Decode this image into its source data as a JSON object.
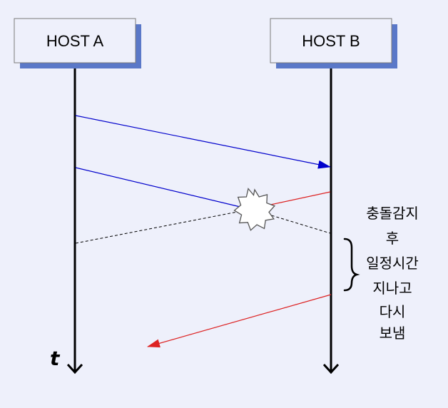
{
  "hosts": [
    {
      "id": "a",
      "label": "HOST A"
    },
    {
      "id": "b",
      "label": "HOST B"
    }
  ],
  "time_label": "t",
  "note_lines": [
    "충돌감지",
    "후",
    "일정시간",
    "지나고",
    "다시",
    "보냄"
  ],
  "colors": {
    "background": "#eef0fb",
    "box_fill": "#eef0fb",
    "box_shadow": "#5a78c8",
    "signal_a": "#0000cc",
    "signal_b": "#dd2222",
    "dashed": "#000000"
  }
}
